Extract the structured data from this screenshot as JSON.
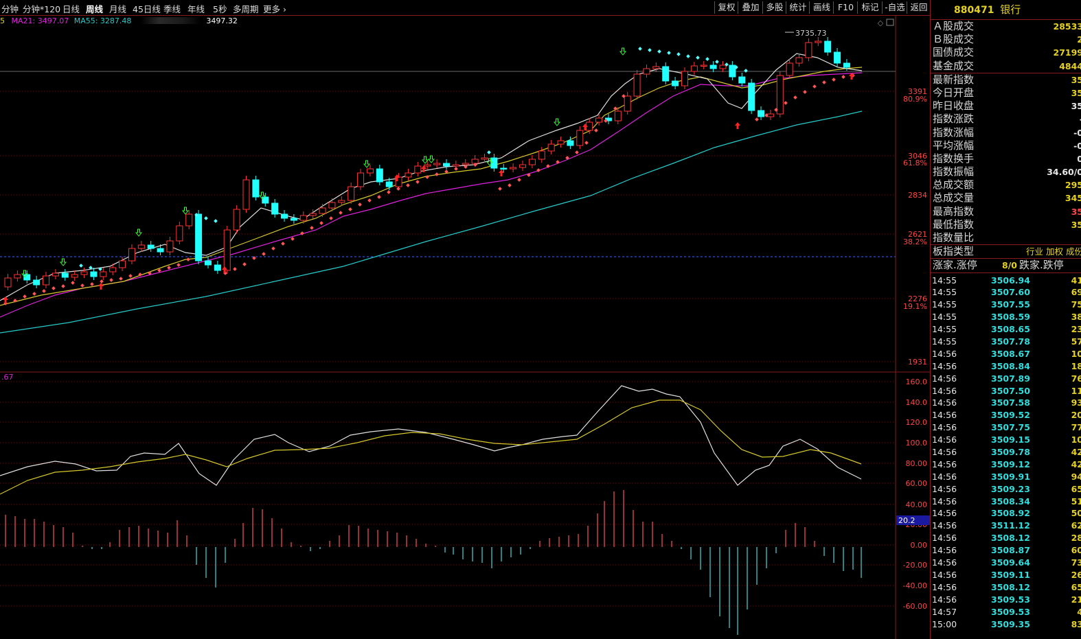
{
  "toolbar": {
    "timeframes": [
      "分钟",
      "分钟*120",
      "日线",
      "周线",
      "月线",
      "45日线",
      "季线",
      "年线",
      "5秒",
      "多周期",
      "更多"
    ],
    "active_timeframe": "周线",
    "buttons": [
      "复权",
      "叠加",
      "多股",
      "统计",
      "画线",
      "F10",
      "标记",
      "-自选",
      "返回"
    ]
  },
  "ma_legend": {
    "prefix": "5",
    "ma21": "MA21: 3497.07",
    "ma55": "MA55: 3287.48",
    "extra": "3497.32",
    "colors": {
      "ma21": "#e020e0",
      "ma55": "#22cccc",
      "extra": "#ffffff"
    }
  },
  "price_axis": {
    "labels": [
      {
        "value": "3391",
        "fib": "80.9%"
      },
      {
        "value": "3046",
        "fib": "61.8%"
      },
      {
        "value": "2834",
        "fib": ""
      },
      {
        "value": "2621",
        "fib": "38.2%"
      },
      {
        "value": "2276",
        "fib": "19.1%"
      },
      {
        "value": "1931",
        "fib": ""
      }
    ],
    "high_marker": "3735.73"
  },
  "indicator": {
    "top_label": ".67",
    "axis_labels": [
      "160.0",
      "140.0",
      "120.0",
      "100.0",
      "80.00",
      "60.00",
      "40.00",
      "20.00",
      "0.00",
      "-20.00",
      "-40.00",
      "-60.00"
    ],
    "current_value": "20.2"
  },
  "colors": {
    "up": "#ff3333",
    "down": "#22ffff",
    "ma_white": "#dddddd",
    "ma_yellow": "#d6c82a",
    "ma_magenta": "#e020e0",
    "ma_cyan": "#22cccc",
    "grid": "#6a0d0d"
  },
  "quote": {
    "code": "880471",
    "name": "银行",
    "stats": [
      {
        "label": "Ａ股成交",
        "value": "28533",
        "color": "#e6d21e"
      },
      {
        "label": "Ｂ股成交",
        "value": "2",
        "color": "#e6d21e"
      },
      {
        "label": "国债成交",
        "value": "27199",
        "color": "#e6d21e"
      },
      {
        "label": "基金成交",
        "value": "4844",
        "color": "#e6d21e"
      },
      {
        "label": "最新指数",
        "value": "35",
        "color": "#e6d21e"
      },
      {
        "label": "今日开盘",
        "value": "35",
        "color": "#e6d21e"
      },
      {
        "label": "昨日收盘",
        "value": "35",
        "color": "#e6e6e6"
      },
      {
        "label": "指数涨跌",
        "value": "-",
        "color": "#e6e6e6"
      },
      {
        "label": "指数涨幅",
        "value": "-0",
        "color": "#e6e6e6"
      },
      {
        "label": "平均涨幅",
        "value": "-0",
        "color": "#e6e6e6"
      },
      {
        "label": "指数换手",
        "value": "0",
        "color": "#e6e6e6"
      },
      {
        "label": "指数振幅",
        "value": "34.60/0",
        "color": "#e6e6e6"
      },
      {
        "label": "总成交额",
        "value": "295",
        "color": "#e6d21e"
      },
      {
        "label": "总成交量",
        "value": "345",
        "color": "#e6d21e"
      },
      {
        "label": "最高指数",
        "value": "35",
        "color": "#ff4444"
      },
      {
        "label": "最低指数",
        "value": "35",
        "color": "#e6d21e"
      },
      {
        "label": "指数量比",
        "value": "",
        "color": "#e6e6e6"
      }
    ],
    "board_type_label": "板指类型",
    "board_type_value": "行业 加权 成份",
    "limit_label_left": "涨家.涨停",
    "limit_value": "8/0",
    "limit_label_right": "跌家.跌停"
  },
  "ticks": [
    {
      "time": "14:55",
      "price": "3506.94",
      "vol": "41"
    },
    {
      "time": "14:55",
      "price": "3507.60",
      "vol": "69"
    },
    {
      "time": "14:55",
      "price": "3507.55",
      "vol": "75"
    },
    {
      "time": "14:55",
      "price": "3508.59",
      "vol": "38"
    },
    {
      "time": "14:55",
      "price": "3508.65",
      "vol": "23"
    },
    {
      "time": "14:55",
      "price": "3507.78",
      "vol": "57"
    },
    {
      "time": "14:56",
      "price": "3508.67",
      "vol": "10"
    },
    {
      "time": "14:56",
      "price": "3508.84",
      "vol": "18"
    },
    {
      "time": "14:56",
      "price": "3507.89",
      "vol": "76"
    },
    {
      "time": "14:56",
      "price": "3507.50",
      "vol": "11"
    },
    {
      "time": "14:56",
      "price": "3507.58",
      "vol": "93"
    },
    {
      "time": "14:56",
      "price": "3509.52",
      "vol": "20"
    },
    {
      "time": "14:56",
      "price": "3507.75",
      "vol": "77"
    },
    {
      "time": "14:56",
      "price": "3509.15",
      "vol": "10"
    },
    {
      "time": "14:56",
      "price": "3509.78",
      "vol": "42"
    },
    {
      "time": "14:56",
      "price": "3509.12",
      "vol": "42"
    },
    {
      "time": "14:56",
      "price": "3509.91",
      "vol": "94"
    },
    {
      "time": "14:56",
      "price": "3509.23",
      "vol": "65"
    },
    {
      "time": "14:56",
      "price": "3508.34",
      "vol": "51"
    },
    {
      "time": "14:56",
      "price": "3508.92",
      "vol": "50"
    },
    {
      "time": "14:56",
      "price": "3511.12",
      "vol": "62"
    },
    {
      "time": "14:56",
      "price": "3508.12",
      "vol": "28"
    },
    {
      "time": "14:56",
      "price": "3508.87",
      "vol": "60"
    },
    {
      "time": "14:56",
      "price": "3509.64",
      "vol": "73"
    },
    {
      "time": "14:56",
      "price": "3509.11",
      "vol": "26"
    },
    {
      "time": "14:56",
      "price": "3508.12",
      "vol": "65"
    },
    {
      "time": "14:56",
      "price": "3509.53",
      "vol": "21"
    },
    {
      "time": "14:57",
      "price": "3509.53",
      "vol": "4"
    },
    {
      "time": "15:00",
      "price": "3509.35",
      "vol": "83"
    }
  ]
}
